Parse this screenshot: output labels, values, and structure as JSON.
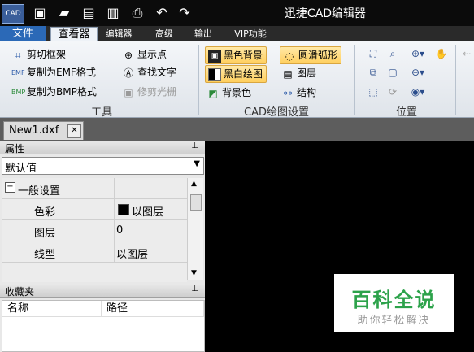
{
  "window": {
    "title": "迅捷CAD编辑器",
    "logo_text": "CAD"
  },
  "quick_access": [
    "new",
    "open",
    "save",
    "save-as",
    "print",
    "undo",
    "redo"
  ],
  "menu_tabs": [
    {
      "label": "文件"
    },
    {
      "label": "查看器"
    },
    {
      "label": "编辑器"
    },
    {
      "label": "高级"
    },
    {
      "label": "输出"
    },
    {
      "label": "VIP功能"
    }
  ],
  "ribbon": {
    "tools": {
      "label": "工具",
      "buttons": [
        "剪切框架",
        "复制为EMF格式",
        "复制为BMP格式",
        "显示点",
        "查找文字",
        "修剪光栅"
      ]
    },
    "drawing": {
      "label": "CAD绘图设置",
      "buttons": [
        "黑色背景",
        "黑白绘图",
        "背景色",
        "圆滑弧形",
        "图层",
        "结构"
      ]
    },
    "position": {
      "label": "位置"
    }
  },
  "document_tab": {
    "label": "New1.dxf"
  },
  "properties": {
    "header": "属性",
    "selector_value": "默认值",
    "group_label": "一般设置",
    "rows": [
      {
        "name": "色彩",
        "value": "以图层"
      },
      {
        "name": "图层",
        "value": "0"
      },
      {
        "name": "线型",
        "value": "以图层"
      }
    ]
  },
  "favorites": {
    "header": "收藏夹",
    "columns": [
      "名称",
      "路径"
    ]
  },
  "watermark": {
    "title": "百科全说",
    "subtitle": "助你轻松解决"
  },
  "colors": {
    "file_tab": "#2b69b7",
    "selected_button": "#ffcf5e",
    "watermark_green": "#2ca24a"
  }
}
